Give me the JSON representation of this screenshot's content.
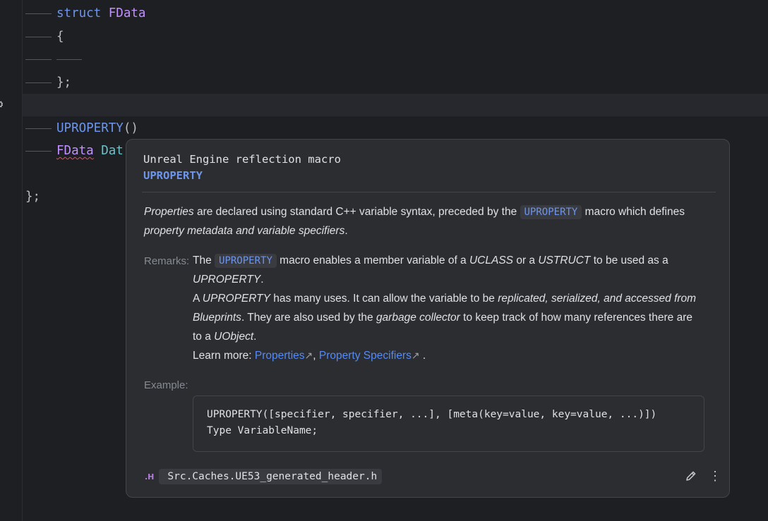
{
  "editor": {
    "lines": [
      {
        "id": "struct",
        "keyword": "struct",
        "name": "FData"
      },
      {
        "id": "brace-open",
        "text": "{"
      },
      {
        "id": "close-inner",
        "text": "};"
      },
      {
        "id": "macro",
        "macro": "UPROPERTY",
        "args": "()"
      },
      {
        "id": "decl",
        "type": "FData",
        "field": "Dat"
      },
      {
        "id": "close-outer",
        "text": "};"
      }
    ],
    "bulb_icon": "lightbulb-icon"
  },
  "popup": {
    "title": "Unreal Engine reflection macro",
    "name": "UPROPERTY",
    "description": {
      "p1_italic": "Properties",
      "p1_text": " are declared using standard C++ variable syntax, preceded by the ",
      "p1_chip": "UPROPERTY",
      "p1_text2": " macro which defines ",
      "p1_italic2": "property metadata and variable specifiers",
      "p1_end": "."
    },
    "remarks": {
      "label": "Remarks:",
      "l1_a": "The ",
      "l1_chip": "UPROPERTY",
      "l1_b": " macro enables a member variable of a ",
      "l1_i1": "UCLASS",
      "l1_c": " or a ",
      "l1_i2": "USTRUCT",
      "l1_d": " to be used as a",
      "l2_i": "UPROPERTY",
      "l2_end": ".",
      "l3_a": "A ",
      "l3_i1": "UPROPERTY",
      "l3_b": " has many uses. It can allow the variable to be ",
      "l3_i2": "replicated, serialized, and accessed from",
      "l4_i": "Blueprints",
      "l4_a": ". They are also used by the ",
      "l4_i2": "garbage collector",
      "l4_b": " to keep track of how many references there are",
      "l5_a": "to a ",
      "l5_i": "UObject",
      "l5_end": ".",
      "learn_more": "Learn more: ",
      "link1": "Properties",
      "link_sep": ", ",
      "link2": "Property Specifiers",
      "link_end": " .",
      "ext_icon": "↗"
    },
    "example": {
      "label": "Example:",
      "code_line1": "UPROPERTY([specifier, specifier, ...], [meta(key=value, key=value, ...)])",
      "code_line2": "Type VariableName;"
    },
    "footer": {
      "file_type": ".H",
      "file_name": "Src.Caches.UE53_generated_header.h",
      "edit_icon": "pencil-icon",
      "more_icon": "more-vertical-icon"
    }
  }
}
